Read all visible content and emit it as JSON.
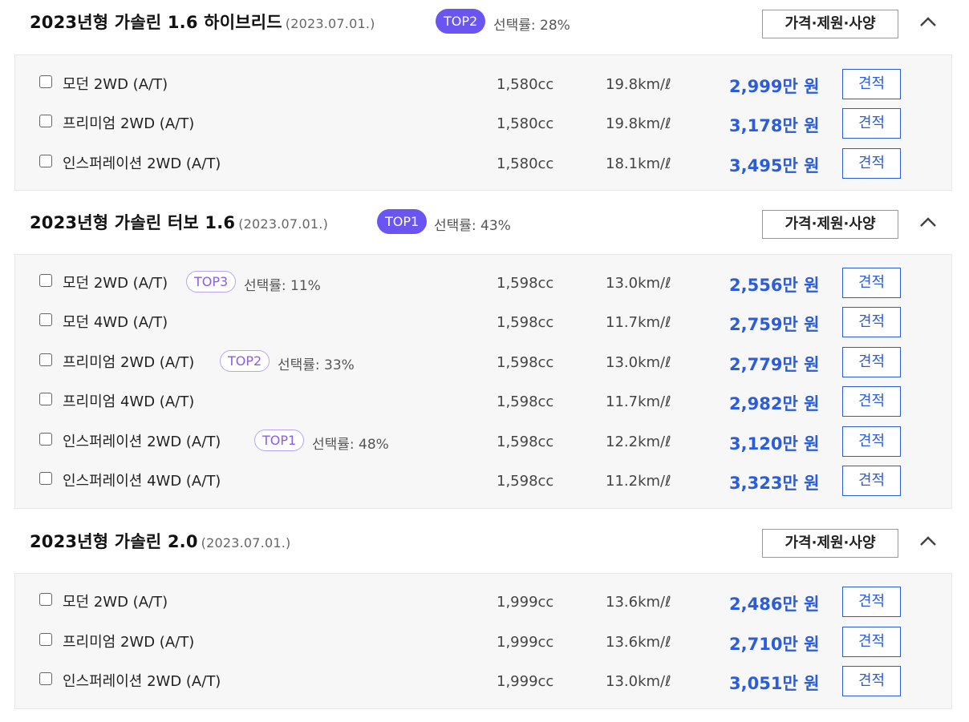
{
  "groups": [
    {
      "title": "2023년형 가솔린 1.6 하이브리드",
      "date": "(2023.07.01.)",
      "rank": "TOP2",
      "rate": "선택률: 28%",
      "spec_button": "가격·제원·사양",
      "trims": [
        {
          "name": "모던 2WD (A/T)",
          "cc": "1,580cc",
          "mileage": "19.8km/ℓ",
          "price": "2,999",
          "unit": "만 원",
          "quote": "견적"
        },
        {
          "name": "프리미엄 2WD (A/T)",
          "cc": "1,580cc",
          "mileage": "19.8km/ℓ",
          "price": "3,178",
          "unit": "만 원",
          "quote": "견적"
        },
        {
          "name": "인스퍼레이션 2WD (A/T)",
          "cc": "1,580cc",
          "mileage": "18.1km/ℓ",
          "price": "3,495",
          "unit": "만 원",
          "quote": "견적"
        }
      ]
    },
    {
      "title": "2023년형 가솔린 터보 1.6",
      "date": "(2023.07.01.)",
      "rank": "TOP1",
      "rate": "선택률: 43%",
      "spec_button": "가격·제원·사양",
      "trims": [
        {
          "name": "모던 2WD (A/T)",
          "rank": "TOP3",
          "rate": "선택률: 11%",
          "cc": "1,598cc",
          "mileage": "13.0km/ℓ",
          "price": "2,556",
          "unit": "만 원",
          "quote": "견적"
        },
        {
          "name": "모던 4WD (A/T)",
          "cc": "1,598cc",
          "mileage": "11.7km/ℓ",
          "price": "2,759",
          "unit": "만 원",
          "quote": "견적"
        },
        {
          "name": "프리미엄 2WD (A/T)",
          "rank": "TOP2",
          "rate": "선택률: 33%",
          "cc": "1,598cc",
          "mileage": "13.0km/ℓ",
          "price": "2,779",
          "unit": "만 원",
          "quote": "견적"
        },
        {
          "name": "프리미엄 4WD (A/T)",
          "cc": "1,598cc",
          "mileage": "11.7km/ℓ",
          "price": "2,982",
          "unit": "만 원",
          "quote": "견적"
        },
        {
          "name": "인스퍼레이션 2WD (A/T)",
          "rank": "TOP1",
          "rate": "선택률: 48%",
          "cc": "1,598cc",
          "mileage": "12.2km/ℓ",
          "price": "3,120",
          "unit": "만 원",
          "quote": "견적"
        },
        {
          "name": "인스퍼레이션 4WD (A/T)",
          "cc": "1,598cc",
          "mileage": "11.2km/ℓ",
          "price": "3,323",
          "unit": "만 원",
          "quote": "견적"
        }
      ]
    },
    {
      "title": "2023년형 가솔린 2.0",
      "date": "(2023.07.01.)",
      "spec_button": "가격·제원·사양",
      "trims": [
        {
          "name": "모던 2WD (A/T)",
          "cc": "1,999cc",
          "mileage": "13.6km/ℓ",
          "price": "2,486",
          "unit": "만 원",
          "quote": "견적"
        },
        {
          "name": "프리미엄 2WD (A/T)",
          "cc": "1,999cc",
          "mileage": "13.6km/ℓ",
          "price": "2,710",
          "unit": "만 원",
          "quote": "견적"
        },
        {
          "name": "인스퍼레이션 2WD (A/T)",
          "cc": "1,999cc",
          "mileage": "13.0km/ℓ",
          "price": "3,051",
          "unit": "만 원",
          "quote": "견적"
        }
      ]
    }
  ],
  "icons": {
    "collapse": "chevron-up-icon",
    "checkbox": "checkbox-icon"
  },
  "colors": {
    "price": "#2a5cdb",
    "top_badge": "#6a55f2",
    "row_badge": "#8a5cf0"
  }
}
